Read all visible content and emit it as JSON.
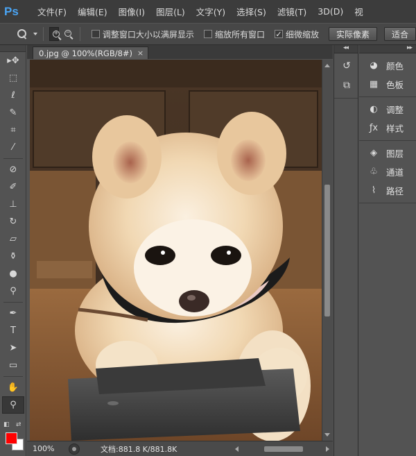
{
  "app": {
    "logo": "Ps"
  },
  "menu": [
    "文件(F)",
    "编辑(E)",
    "图像(I)",
    "图层(L)",
    "文字(Y)",
    "选择(S)",
    "滤镜(T)",
    "3D(D)",
    "视"
  ],
  "options": {
    "resize_windows_label": "调整窗口大小以满屏显示",
    "resize_windows_checked": false,
    "zoom_all_label": "缩放所有窗口",
    "zoom_all_checked": false,
    "scrubby_zoom_label": "细微缩放",
    "scrubby_zoom_checked": true,
    "actual_pixels_label": "实际像素",
    "fit_screen_label": "适合",
    "checkmark": "✓"
  },
  "document": {
    "tab_title": "0.jpg @ 100%(RGB/8#)",
    "tab_close": "×",
    "zoom": "100%",
    "doc_info": "文档:881.8 K/881.8K"
  },
  "tools": [
    {
      "name": "move-tool-icon",
      "glyph": "▸✥"
    },
    {
      "name": "marquee-tool-icon",
      "glyph": "⬚"
    },
    {
      "name": "lasso-tool-icon",
      "glyph": "ℓ"
    },
    {
      "name": "quick-selection-tool-icon",
      "glyph": "✎"
    },
    {
      "name": "crop-tool-icon",
      "glyph": "⌗"
    },
    {
      "name": "eyedropper-tool-icon",
      "glyph": "⁄"
    },
    {
      "name": "healing-brush-tool-icon",
      "glyph": "⊘"
    },
    {
      "name": "brush-tool-icon",
      "glyph": "✐"
    },
    {
      "name": "clone-stamp-tool-icon",
      "glyph": "⊥"
    },
    {
      "name": "history-brush-tool-icon",
      "glyph": "↻"
    },
    {
      "name": "eraser-tool-icon",
      "glyph": "▱"
    },
    {
      "name": "paint-bucket-tool-icon",
      "glyph": "⚱"
    },
    {
      "name": "blur-tool-icon",
      "glyph": "●"
    },
    {
      "name": "dodge-tool-icon",
      "glyph": "⚲"
    },
    {
      "name": "pen-tool-icon",
      "glyph": "✒"
    },
    {
      "name": "type-tool-icon",
      "glyph": "T"
    },
    {
      "name": "path-selection-tool-icon",
      "glyph": "➤"
    },
    {
      "name": "rectangle-tool-icon",
      "glyph": "▭"
    },
    {
      "name": "hand-tool-icon",
      "glyph": "✋"
    },
    {
      "name": "zoom-tool-icon",
      "glyph": "⚲"
    }
  ],
  "colors": {
    "foreground": "#ff0000",
    "background": "#ffffff"
  },
  "dock_narrow": [
    {
      "name": "history-panel-icon",
      "glyph": "↺"
    },
    {
      "name": "3d-panel-icon",
      "glyph": "⧉"
    }
  ],
  "panels": [
    {
      "group": [
        {
          "name": "color",
          "label": "颜色",
          "icon": "color-palette-icon",
          "glyph": "◕"
        },
        {
          "name": "swatches",
          "label": "色板",
          "icon": "swatches-icon",
          "glyph": "▦"
        }
      ]
    },
    {
      "group": [
        {
          "name": "adjustments",
          "label": "调整",
          "icon": "adjustments-icon",
          "glyph": "◐"
        },
        {
          "name": "styles",
          "label": "样式",
          "icon": "styles-icon",
          "glyph": "ƒx"
        }
      ]
    },
    {
      "group": [
        {
          "name": "layers",
          "label": "图层",
          "icon": "layers-icon",
          "glyph": "◈"
        },
        {
          "name": "channels",
          "label": "通道",
          "icon": "channels-icon",
          "glyph": "♧"
        },
        {
          "name": "paths",
          "label": "路径",
          "icon": "paths-icon",
          "glyph": "⌇"
        }
      ]
    }
  ]
}
